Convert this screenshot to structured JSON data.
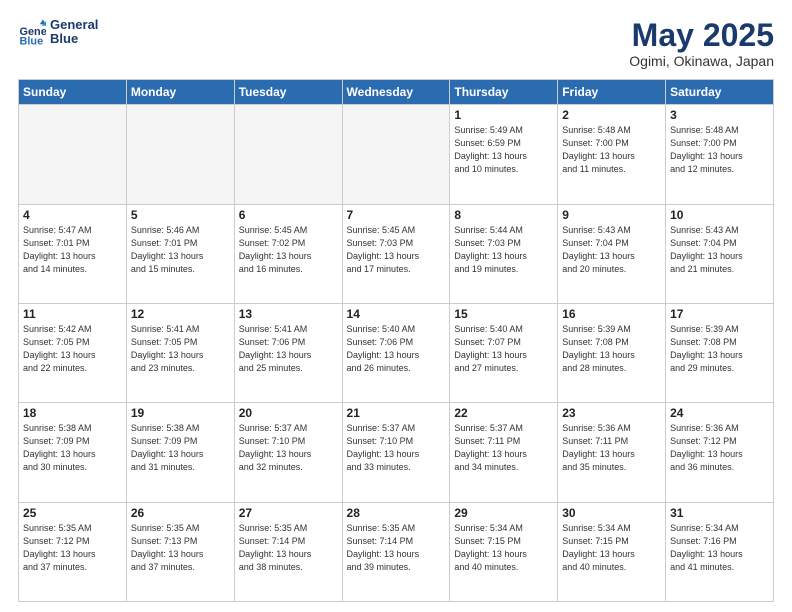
{
  "header": {
    "logo_line1": "General",
    "logo_line2": "Blue",
    "month": "May 2025",
    "location": "Ogimi, Okinawa, Japan"
  },
  "weekdays": [
    "Sunday",
    "Monday",
    "Tuesday",
    "Wednesday",
    "Thursday",
    "Friday",
    "Saturday"
  ],
  "weeks": [
    [
      {
        "day": "",
        "empty": true
      },
      {
        "day": "",
        "empty": true
      },
      {
        "day": "",
        "empty": true
      },
      {
        "day": "",
        "empty": true
      },
      {
        "day": "1",
        "sunrise": "5:49 AM",
        "sunset": "6:59 PM",
        "daylight": "13 hours and 10 minutes."
      },
      {
        "day": "2",
        "sunrise": "5:48 AM",
        "sunset": "7:00 PM",
        "daylight": "13 hours and 11 minutes."
      },
      {
        "day": "3",
        "sunrise": "5:48 AM",
        "sunset": "7:00 PM",
        "daylight": "13 hours and 12 minutes."
      }
    ],
    [
      {
        "day": "4",
        "sunrise": "5:47 AM",
        "sunset": "7:01 PM",
        "daylight": "13 hours and 14 minutes."
      },
      {
        "day": "5",
        "sunrise": "5:46 AM",
        "sunset": "7:01 PM",
        "daylight": "13 hours and 15 minutes."
      },
      {
        "day": "6",
        "sunrise": "5:45 AM",
        "sunset": "7:02 PM",
        "daylight": "13 hours and 16 minutes."
      },
      {
        "day": "7",
        "sunrise": "5:45 AM",
        "sunset": "7:03 PM",
        "daylight": "13 hours and 17 minutes."
      },
      {
        "day": "8",
        "sunrise": "5:44 AM",
        "sunset": "7:03 PM",
        "daylight": "13 hours and 19 minutes."
      },
      {
        "day": "9",
        "sunrise": "5:43 AM",
        "sunset": "7:04 PM",
        "daylight": "13 hours and 20 minutes."
      },
      {
        "day": "10",
        "sunrise": "5:43 AM",
        "sunset": "7:04 PM",
        "daylight": "13 hours and 21 minutes."
      }
    ],
    [
      {
        "day": "11",
        "sunrise": "5:42 AM",
        "sunset": "7:05 PM",
        "daylight": "13 hours and 22 minutes."
      },
      {
        "day": "12",
        "sunrise": "5:41 AM",
        "sunset": "7:05 PM",
        "daylight": "13 hours and 23 minutes."
      },
      {
        "day": "13",
        "sunrise": "5:41 AM",
        "sunset": "7:06 PM",
        "daylight": "13 hours and 25 minutes."
      },
      {
        "day": "14",
        "sunrise": "5:40 AM",
        "sunset": "7:06 PM",
        "daylight": "13 hours and 26 minutes."
      },
      {
        "day": "15",
        "sunrise": "5:40 AM",
        "sunset": "7:07 PM",
        "daylight": "13 hours and 27 minutes."
      },
      {
        "day": "16",
        "sunrise": "5:39 AM",
        "sunset": "7:08 PM",
        "daylight": "13 hours and 28 minutes."
      },
      {
        "day": "17",
        "sunrise": "5:39 AM",
        "sunset": "7:08 PM",
        "daylight": "13 hours and 29 minutes."
      }
    ],
    [
      {
        "day": "18",
        "sunrise": "5:38 AM",
        "sunset": "7:09 PM",
        "daylight": "13 hours and 30 minutes."
      },
      {
        "day": "19",
        "sunrise": "5:38 AM",
        "sunset": "7:09 PM",
        "daylight": "13 hours and 31 minutes."
      },
      {
        "day": "20",
        "sunrise": "5:37 AM",
        "sunset": "7:10 PM",
        "daylight": "13 hours and 32 minutes."
      },
      {
        "day": "21",
        "sunrise": "5:37 AM",
        "sunset": "7:10 PM",
        "daylight": "13 hours and 33 minutes."
      },
      {
        "day": "22",
        "sunrise": "5:37 AM",
        "sunset": "7:11 PM",
        "daylight": "13 hours and 34 minutes."
      },
      {
        "day": "23",
        "sunrise": "5:36 AM",
        "sunset": "7:11 PM",
        "daylight": "13 hours and 35 minutes."
      },
      {
        "day": "24",
        "sunrise": "5:36 AM",
        "sunset": "7:12 PM",
        "daylight": "13 hours and 36 minutes."
      }
    ],
    [
      {
        "day": "25",
        "sunrise": "5:35 AM",
        "sunset": "7:12 PM",
        "daylight": "13 hours and 37 minutes."
      },
      {
        "day": "26",
        "sunrise": "5:35 AM",
        "sunset": "7:13 PM",
        "daylight": "13 hours and 37 minutes."
      },
      {
        "day": "27",
        "sunrise": "5:35 AM",
        "sunset": "7:14 PM",
        "daylight": "13 hours and 38 minutes."
      },
      {
        "day": "28",
        "sunrise": "5:35 AM",
        "sunset": "7:14 PM",
        "daylight": "13 hours and 39 minutes."
      },
      {
        "day": "29",
        "sunrise": "5:34 AM",
        "sunset": "7:15 PM",
        "daylight": "13 hours and 40 minutes."
      },
      {
        "day": "30",
        "sunrise": "5:34 AM",
        "sunset": "7:15 PM",
        "daylight": "13 hours and 40 minutes."
      },
      {
        "day": "31",
        "sunrise": "5:34 AM",
        "sunset": "7:16 PM",
        "daylight": "13 hours and 41 minutes."
      }
    ]
  ]
}
